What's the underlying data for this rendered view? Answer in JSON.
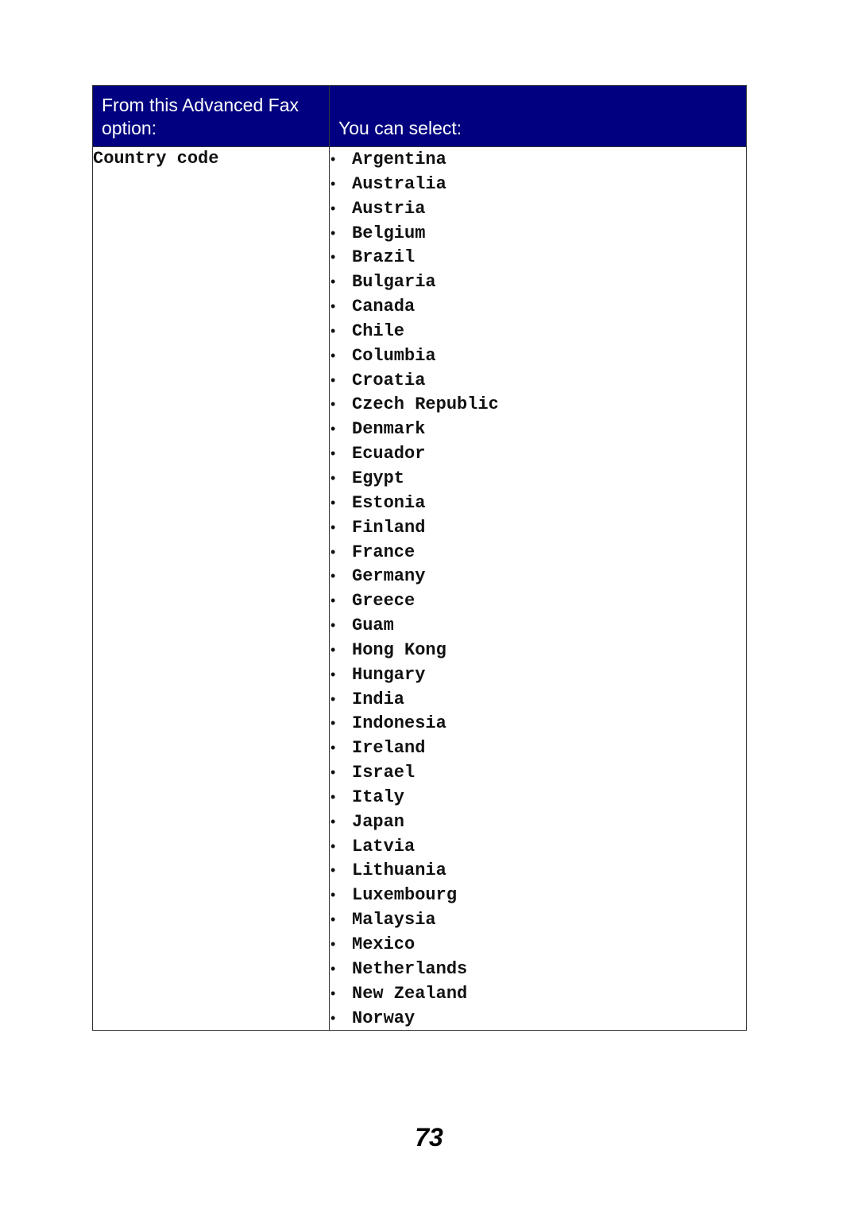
{
  "table": {
    "header": {
      "option_label": "From this Advanced Fax option:",
      "values_label": "You can select:",
      "background_color": "#000080"
    },
    "rows": [
      {
        "option": "Country code",
        "values": [
          "Argentina",
          "Australia",
          "Austria",
          "Belgium",
          "Brazil",
          "Bulgaria",
          "Canada",
          "Chile",
          "Columbia",
          "Croatia",
          "Czech Republic",
          "Denmark",
          "Ecuador",
          "Egypt",
          "Estonia",
          "Finland",
          "France",
          "Germany",
          "Greece",
          "Guam",
          "Hong Kong",
          "Hungary",
          "India",
          "Indonesia",
          "Ireland",
          "Israel",
          "Italy",
          "Japan",
          "Latvia",
          "Lithuania",
          "Luxembourg",
          "Malaysia",
          "Mexico",
          "Netherlands",
          "New Zealand",
          "Norway"
        ]
      }
    ],
    "bullet_glyph": "•"
  },
  "page": {
    "number": "73"
  }
}
